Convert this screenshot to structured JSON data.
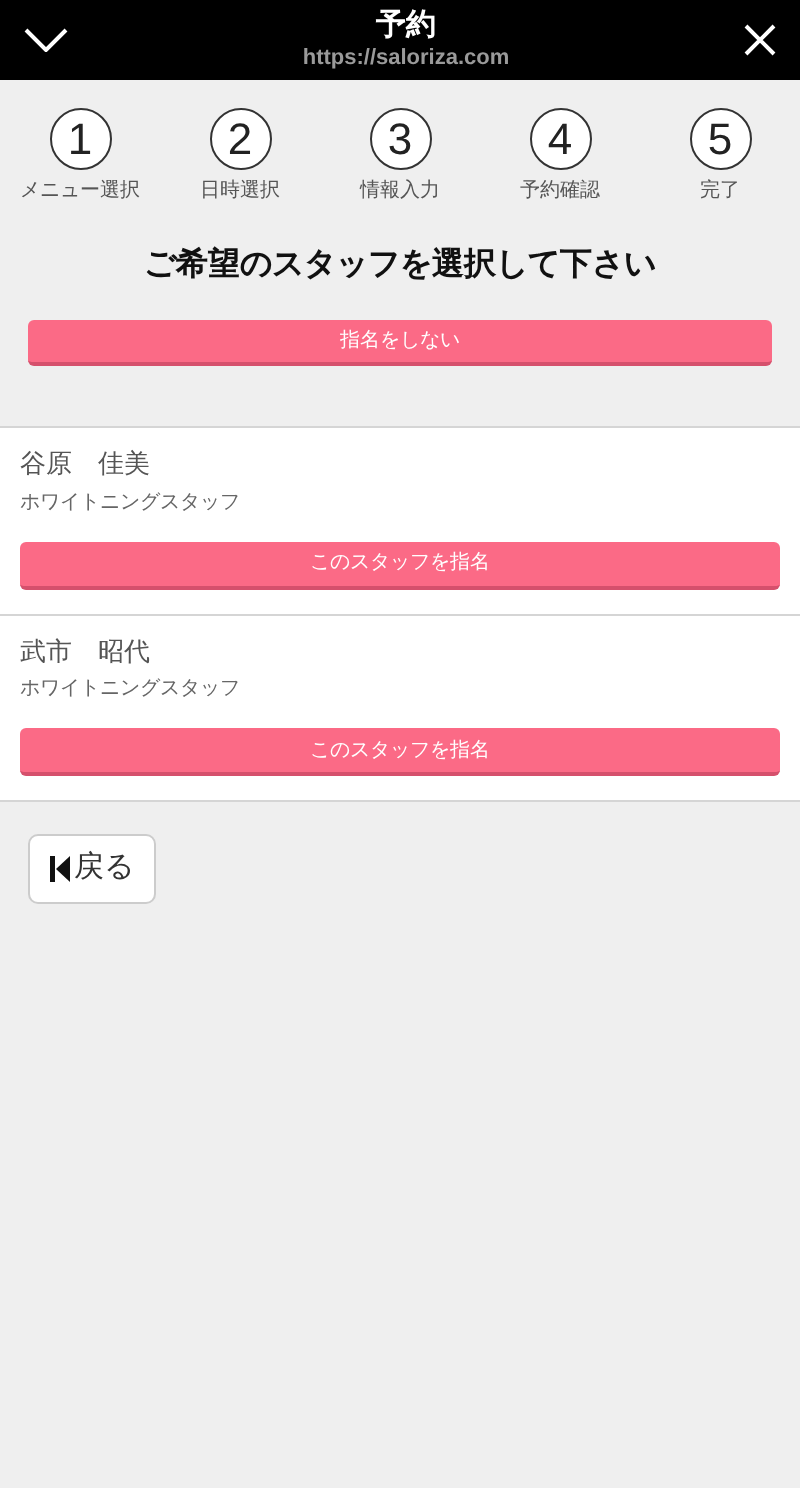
{
  "header": {
    "title": "予約",
    "url": "https://saloriza.com"
  },
  "steps": [
    {
      "number": "1",
      "label": "メニュー選択"
    },
    {
      "number": "2",
      "label": "日時選択"
    },
    {
      "number": "3",
      "label": "情報入力"
    },
    {
      "number": "4",
      "label": "予約確認"
    },
    {
      "number": "5",
      "label": "完了"
    }
  ],
  "heading": "ご希望のスタッフを選択して下さい",
  "no_preference_button": "指名をしない",
  "staff": [
    {
      "name": "谷原　佳美",
      "role": "ホワイトニングスタッフ",
      "button": "このスタッフを指名"
    },
    {
      "name": "武市　昭代",
      "role": "ホワイトニングスタッフ",
      "button": "このスタッフを指名"
    }
  ],
  "back_button": "戻る"
}
